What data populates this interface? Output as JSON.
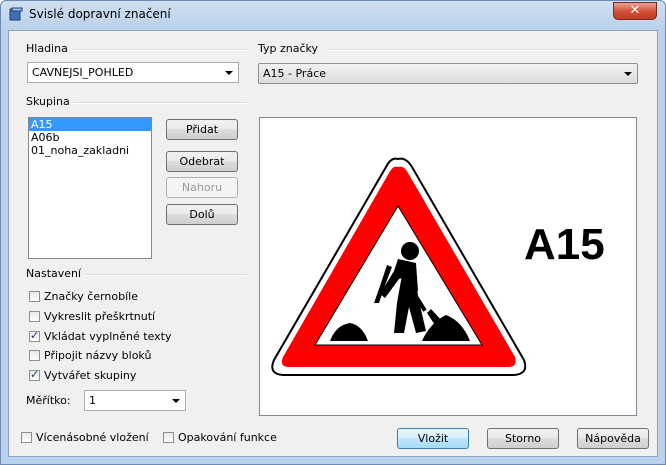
{
  "window": {
    "title": "Svislé dopravní značení",
    "close_symbol": "✕"
  },
  "layer": {
    "label": "Hladina",
    "value": "CAVNEJSI_POHLED"
  },
  "group": {
    "label": "Skupina",
    "items": [
      "A15",
      "A06b",
      "01_noha_zakladni"
    ],
    "selected_index": 0
  },
  "buttons": {
    "add": "Přidat",
    "remove": "Odebrat",
    "up": "Nahoru",
    "down": "Dolů"
  },
  "settings": {
    "label": "Nastavení",
    "options": [
      {
        "label": "Značky černobíle",
        "checked": false
      },
      {
        "label": "Vykreslit přeškrtnutí",
        "checked": false
      },
      {
        "label": "Vkládat vyplněné texty",
        "checked": true
      },
      {
        "label": "Připojit názvy bloků",
        "checked": false
      },
      {
        "label": "Vytvářet skupiny",
        "checked": true
      }
    ],
    "scale_label": "Měřítko:",
    "scale_value": "1"
  },
  "sign_type": {
    "label": "Typ značky",
    "value": "A15 - Práce"
  },
  "preview": {
    "code": "A15"
  },
  "footer": {
    "multi_insert": {
      "label": "Vícenásobné vložení",
      "checked": false
    },
    "repeat_function": {
      "label": "Opakování funkce",
      "checked": false
    },
    "insert": "Vložit",
    "cancel": "Storno",
    "help": "Nápověda"
  },
  "colors": {
    "sign_red": "#ff0000",
    "selection": "#3399ff"
  }
}
